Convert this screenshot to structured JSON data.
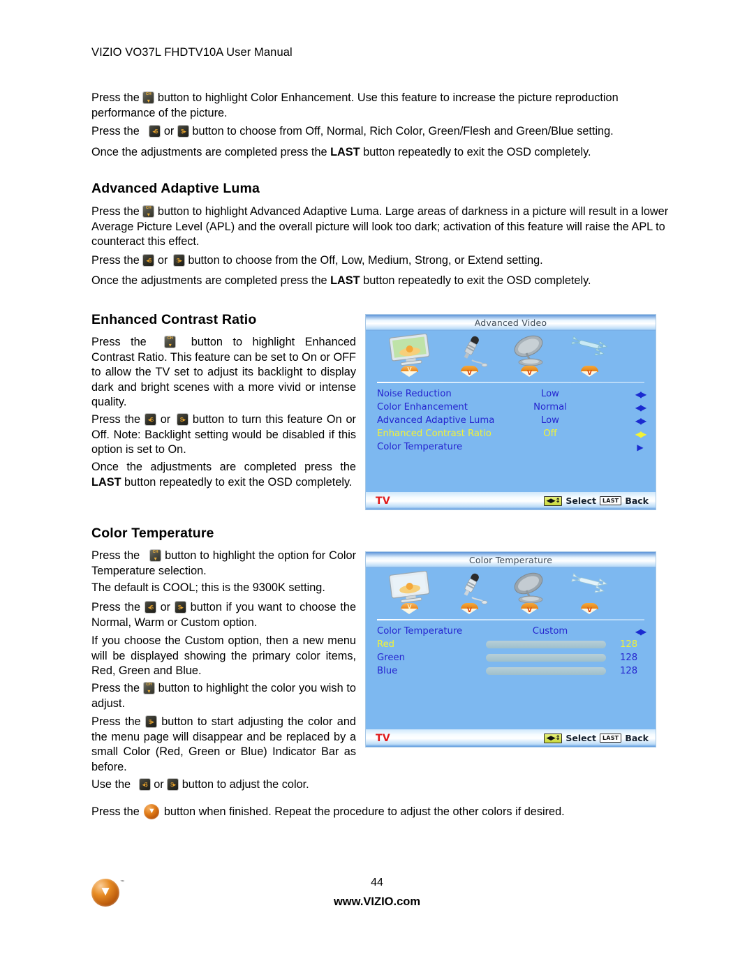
{
  "document": {
    "header": "VIZIO VO37L FHDTV10A User Manual",
    "page_number": "44",
    "website": "www.VIZIO.com",
    "logo_tm": "™"
  },
  "intro": {
    "p1_a": "Press the",
    "p1_b": "button to highlight Color Enhancement.  Use this feature to increase the picture reproduction performance of the picture.",
    "p2_a": "Press the",
    "p2_or": "or",
    "p2_b": "button to choose from Off, Normal, Rich Color, Green/Flesh and Green/Blue setting.",
    "p3_a": "Once the adjustments are completed press the",
    "p3_bold": "LAST",
    "p3_b": "button repeatedly to exit the OSD completely."
  },
  "section_luma": {
    "heading": "Advanced Adaptive Luma",
    "p1_a": "Press the",
    "p1_b": "button to highlight Advanced Adaptive Luma. Large areas of darkness in a picture will result in a lower Average Picture Level (APL) and the overall picture will look too dark; activation of this feature will raise the APL to counteract this effect.",
    "p2_a": "Press the",
    "p2_or": "or",
    "p2_b": "button to choose from the Off, Low, Medium, Strong, or Extend setting.",
    "p3_a": "Once the adjustments are completed press the",
    "p3_bold": "LAST",
    "p3_b": "button repeatedly to exit the OSD completely."
  },
  "section_contrast": {
    "heading": "Enhanced Contrast Ratio",
    "p1_a": "Press the",
    "p1_b": "button to highlight Enhanced Contrast Ratio.  This feature can be set to On or OFF to allow the TV set to adjust its backlight to display dark and bright scenes with a more vivid or intense quality.",
    "p2_a": "Press the",
    "p2_or": "or",
    "p2_b": "button to turn this feature On or Off. Note: Backlight setting would be disabled if this option is set to On.",
    "p3_a": "Once the adjustments are completed press the",
    "p3_bold": "LAST",
    "p3_b": "button repeatedly to exit the OSD completely."
  },
  "section_colortemp": {
    "heading": "Color Temperature",
    "p1_a": "Press the",
    "p1_b": "button to highlight the option for Color Temperature selection.",
    "p2": "The default is COOL; this is the 9300K setting.",
    "p3_a": "Press the",
    "p3_or": "or",
    "p3_b": "button if you want to choose the Normal, Warm or Custom option.",
    "p4": "If you choose the Custom option, then a new menu will be displayed showing the primary color items, Red, Green and Blue.",
    "p5_a": "Press the",
    "p5_b": "button to highlight the color you wish to adjust.",
    "p6_a": "Press the",
    "p6_b": "button to start adjusting the color and the menu page will disappear and be replaced by a small Color (Red, Green or Blue) Indicator Bar as before.",
    "p7_a": "Use the",
    "p7_or": "or",
    "p7_b": "button to adjust the color.",
    "p8_a": "Press the",
    "p8_b": "button when finished.  Repeat the procedure to adjust the other colors if desired."
  },
  "osd_advanced_video": {
    "title": "Advanced Video",
    "source": "TV",
    "hint_select": "Select",
    "hint_back": "Back",
    "key_nav": "◀▶↕",
    "key_last": "LAST",
    "tabs": [
      {
        "name": "picture-icon",
        "selected": true
      },
      {
        "name": "audio-icon",
        "selected": false
      },
      {
        "name": "tuner-icon",
        "selected": false
      },
      {
        "name": "setup-icon",
        "selected": false
      }
    ],
    "rows": [
      {
        "label": "Noise Reduction",
        "value": "Low",
        "arrows": "◀▶",
        "highlighted": false
      },
      {
        "label": "Color Enhancement",
        "value": "Normal",
        "arrows": "◀▶",
        "highlighted": false
      },
      {
        "label": "Advanced Adaptive Luma",
        "value": "Low",
        "arrows": "◀▶",
        "highlighted": false
      },
      {
        "label": "Enhanced Contrast Ratio",
        "value": "Off",
        "arrows": "◀▶",
        "highlighted": true
      },
      {
        "label": "Color Temperature",
        "value": "",
        "arrows": "▶",
        "highlighted": false
      }
    ]
  },
  "osd_color_temperature": {
    "title": "Color Temperature",
    "source": "TV",
    "hint_select": "Select",
    "hint_back": "Back",
    "key_nav": "◀▶↕",
    "key_last": "LAST",
    "tabs": [
      {
        "name": "picture-icon",
        "selected": true
      },
      {
        "name": "audio-icon",
        "selected": false
      },
      {
        "name": "tuner-icon",
        "selected": false
      },
      {
        "name": "setup-icon",
        "selected": false
      }
    ],
    "option_row": {
      "label": "Color Temperature",
      "value": "Custom",
      "arrows": "◀▶"
    },
    "sliders": [
      {
        "label": "Red",
        "value": "128",
        "percent": 50,
        "highlighted": true
      },
      {
        "label": "Green",
        "value": "128",
        "percent": 50,
        "highlighted": false
      },
      {
        "label": "Blue",
        "value": "128",
        "percent": 50,
        "highlighted": false
      }
    ]
  }
}
